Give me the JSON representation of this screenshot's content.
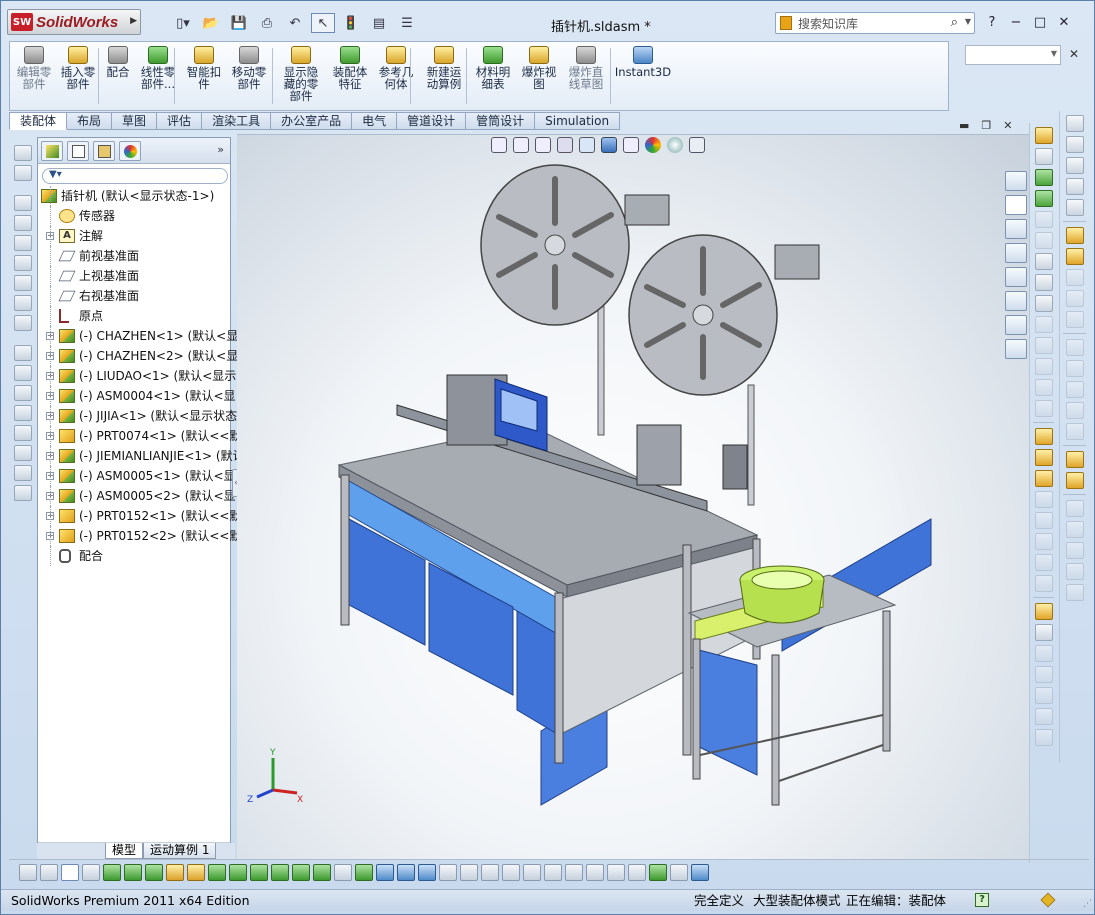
{
  "app": {
    "logo_text": "SolidWorks",
    "logo_badge": "SW",
    "doc_title": "插针机.sldasm *",
    "search_placeholder": "搜索知识库",
    "window_controls": [
      "?",
      "−",
      "□",
      "✕"
    ]
  },
  "quick_access": [
    "new-icon",
    "open-icon",
    "save-icon",
    "print-icon",
    "undo-icon",
    "select-icon",
    "rebuild-icon",
    "file-properties-icon",
    "options-icon"
  ],
  "command_manager": {
    "buttons": [
      {
        "label": "编辑零\n部件",
        "enabled": false
      },
      {
        "label": "插入零\n部件",
        "enabled": true
      },
      {
        "label": "配合",
        "enabled": true
      },
      {
        "label": "线性零\n部件...",
        "enabled": true
      },
      {
        "label": "智能扣\n件",
        "enabled": true
      },
      {
        "label": "移动零\n部件",
        "enabled": true
      },
      {
        "label": "显示隐\n藏的零\n部件",
        "enabled": true
      },
      {
        "label": "装配体\n特征",
        "enabled": true
      },
      {
        "label": "参考几\n何体",
        "enabled": true
      },
      {
        "label": "新建运\n动算例",
        "enabled": true
      },
      {
        "label": "材料明\n细表",
        "enabled": true
      },
      {
        "label": "爆炸视\n图",
        "enabled": true
      },
      {
        "label": "爆炸直\n线草图",
        "enabled": false
      },
      {
        "label": "Instant3D",
        "enabled": true
      }
    ]
  },
  "tabs": [
    "装配体",
    "布局",
    "草图",
    "评估",
    "渲染工具",
    "办公室产品",
    "电气",
    "管道设计",
    "管筒设计",
    "Simulation"
  ],
  "active_tab": "装配体",
  "feature_tree": {
    "root": "插针机  (默认<显示状态-1>)",
    "items": [
      {
        "label": "传感器",
        "icon": "sensor-icon",
        "expand": false
      },
      {
        "label": "注解",
        "icon": "annotation-icon",
        "expand": true
      },
      {
        "label": "前视基准面",
        "icon": "plane-icon",
        "expand": false
      },
      {
        "label": "上视基准面",
        "icon": "plane-icon",
        "expand": false
      },
      {
        "label": "右视基准面",
        "icon": "plane-icon",
        "expand": false
      },
      {
        "label": "原点",
        "icon": "origin-icon",
        "expand": false
      },
      {
        "label": "(-) CHAZHEN<1> (默认<显",
        "icon": "subassembly-icon",
        "expand": true
      },
      {
        "label": "(-) CHAZHEN<2> (默认<显",
        "icon": "subassembly-icon",
        "expand": true
      },
      {
        "label": "(-) LIUDAO<1> (默认<显示",
        "icon": "subassembly-icon",
        "expand": true
      },
      {
        "label": "(-) ASM0004<1> (默认<显",
        "icon": "subassembly-icon",
        "expand": true
      },
      {
        "label": "(-) JIJIA<1> (默认<显示状态",
        "icon": "subassembly-icon",
        "expand": true
      },
      {
        "label": "(-) PRT0074<1> (默认<<默",
        "icon": "part-icon",
        "expand": true
      },
      {
        "label": "(-) JIEMIANLIANJIE<1> (默认",
        "icon": "subassembly-icon",
        "expand": true
      },
      {
        "label": "(-) ASM0005<1> (默认<显",
        "icon": "subassembly-icon",
        "expand": true
      },
      {
        "label": "(-) ASM0005<2> (默认<显",
        "icon": "subassembly-icon",
        "expand": true
      },
      {
        "label": "(-) PRT0152<1> (默认<<默",
        "icon": "part-icon",
        "expand": true
      },
      {
        "label": "(-) PRT0152<2> (默认<<默",
        "icon": "part-icon",
        "expand": true
      },
      {
        "label": "配合",
        "icon": "mates-icon",
        "expand": false
      }
    ]
  },
  "bottom_tabs": [
    "模型",
    "运动算例 1"
  ],
  "triad": {
    "x": "X",
    "y": "Y",
    "z": "Z"
  },
  "status": {
    "app": "SolidWorks Premium 2011 x64 Edition",
    "defined": "完全定义",
    "mode": "大型装配体模式",
    "editing": "正在编辑：装配体",
    "help": "?"
  },
  "colors": {
    "accent": "#2f59c9",
    "enclosure": "#3f73d8",
    "bowl": "#c9f06b",
    "frame": "#b8bcc2"
  }
}
